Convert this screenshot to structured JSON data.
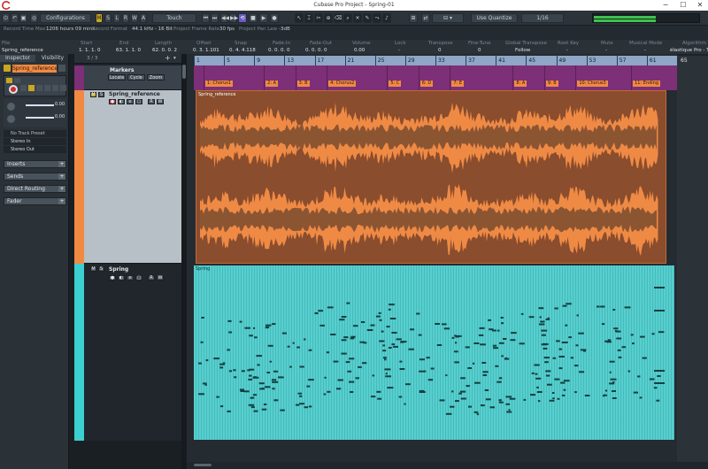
{
  "window": {
    "title": "Cubase Pro Project - Spring-01",
    "minimize": "─",
    "maximize": "☐",
    "close": "✕"
  },
  "toolbar": {
    "configurations": "Configurations",
    "m": "M",
    "s": "S",
    "l": "L",
    "r": "R",
    "w": "W",
    "a": "A",
    "automation_mode": "Touch",
    "quantize": "Use Quantize",
    "quantize_value": "1/16"
  },
  "infoline_top": {
    "record_time_max_label": "Record Time Max",
    "record_time_max": "1206 hours 09 mins",
    "record_format_label": "Record Format",
    "record_format": "44.1 kHz - 16 Bit",
    "frame_rate_label": "Project Frame Rate",
    "frame_rate": "30 fps",
    "pan_law_label": "Project Pan Law",
    "pan_law": "-3dB"
  },
  "infoline": {
    "headers": [
      "File",
      "Start",
      "End",
      "Length",
      "Offset",
      "Snap",
      "Fade-In",
      "Fade-Out",
      "Volume",
      "Lock",
      "Transpose",
      "Fine-Tune",
      "Global Transpose",
      "Root Key",
      "Mute",
      "Musical Mode",
      "Algorithm"
    ],
    "values": [
      "Spring_reference",
      "1. 1. 1. 0",
      "63. 1. 1. 0",
      "62. 0. 0. 2",
      "0. 3. 1.101",
      "0. 4. 4.118",
      "0. 0. 0. 0",
      "0. 0. 0. 0",
      "0.00",
      "-",
      "0",
      "0",
      "Follow",
      "-",
      "-",
      "-",
      "élastique Pro - Tim"
    ]
  },
  "inspector": {
    "tab_inspector": "Inspector",
    "tab_visibility": "Visibility",
    "track_name": "Spring_reference",
    "volume_value": "0.00",
    "pan_value": "0.00",
    "track_preset": "No Track Preset",
    "input": "Stereo In",
    "output": "Stereo Out",
    "sections": [
      "Inserts",
      "Sends",
      "Direct Routing",
      "Fader"
    ]
  },
  "tracklist": {
    "count": "3 / 3",
    "markers_name": "Markers",
    "locate": "Locate",
    "cycle": "Cycle",
    "zoom": "Zoom",
    "track1_name": "Spring_reference",
    "track2_name": "Spring",
    "m": "M",
    "s": "S",
    "r": "R",
    "w": "W",
    "e": "e"
  },
  "ruler": {
    "bars": [
      "1",
      "5",
      "9",
      "13",
      "17",
      "21",
      "25",
      "29",
      "33",
      "37",
      "41",
      "45",
      "49",
      "53",
      "57",
      "61"
    ],
    "end_bar": "65"
  },
  "markers": [
    {
      "label": "1: Chorus1",
      "pos": 0.02
    },
    {
      "label": "2: A",
      "pos": 0.145
    },
    {
      "label": "3: B",
      "pos": 0.21
    },
    {
      "label": "4: Chorus2",
      "pos": 0.275
    },
    {
      "label": "5: C",
      "pos": 0.4
    },
    {
      "label": "6: D",
      "pos": 0.465
    },
    {
      "label": "7: E",
      "pos": 0.53
    },
    {
      "label": "8: A",
      "pos": 0.66
    },
    {
      "label": "9: B",
      "pos": 0.725
    },
    {
      "label": "10: Chorus3",
      "pos": 0.79
    },
    {
      "label": "11: Ending",
      "pos": 0.905
    }
  ],
  "events": {
    "audio_name": "Spring_reference",
    "midi_name": "Spring"
  },
  "colors": {
    "audio_track": "#f08a43",
    "midi_track": "#3ccfd0",
    "marker_track": "#7d2f77",
    "ruler": "#8fa6c6"
  }
}
